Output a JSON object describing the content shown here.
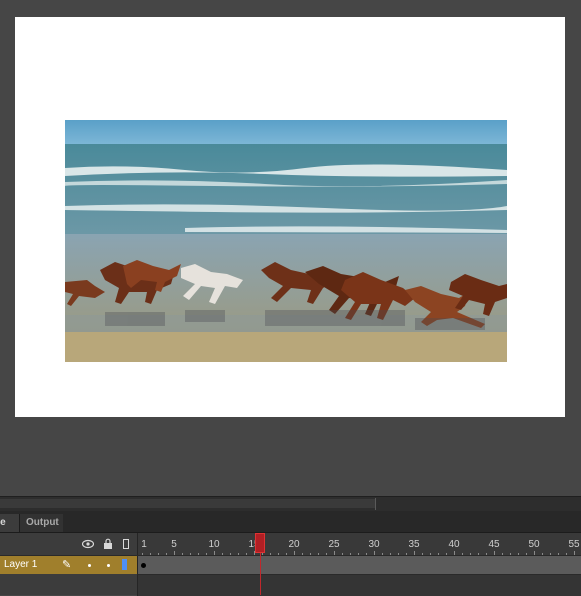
{
  "panel": {
    "tabs": [
      {
        "label": "ne",
        "active": true
      },
      {
        "label": "Output",
        "active": false
      }
    ]
  },
  "timeline": {
    "ruler_labels": [
      "1",
      "5",
      "10",
      "15",
      "20",
      "25",
      "30",
      "35",
      "40",
      "45",
      "50",
      "55"
    ],
    "current_frame": 15,
    "header_icons": [
      "eye-icon",
      "lock-icon",
      "outline-icon"
    ]
  },
  "layers": [
    {
      "name": "Layer 1",
      "color": "#4f8ff5",
      "selected": true,
      "keyframe_at": 1
    }
  ],
  "colors": {
    "layer_highlight": "#a07f2c",
    "playhead": "#b01f24",
    "stage": "#ffffff",
    "workspace": "#464646"
  }
}
